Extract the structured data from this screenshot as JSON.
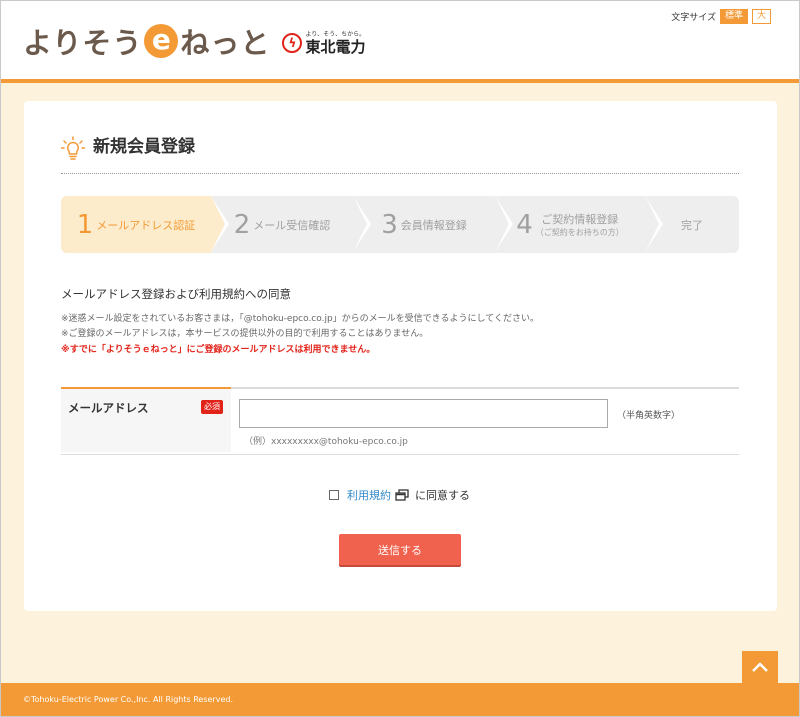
{
  "header": {
    "logo_text_1": "よりそう",
    "logo_e": "e",
    "logo_text_2": "ねっと",
    "brand_tag": "より、そう、ちから。",
    "brand_name": "東北電力",
    "font_size_label": "文字サイズ",
    "font_size_standard": "標準",
    "font_size_large": "大"
  },
  "main": {
    "title": "新規会員登録",
    "steps": [
      {
        "num": "1",
        "label": "メールアドレス認証",
        "sub": ""
      },
      {
        "num": "2",
        "label": "メール受信確認",
        "sub": ""
      },
      {
        "num": "3",
        "label": "会員情報登録",
        "sub": ""
      },
      {
        "num": "4",
        "label": "ご契約情報登録",
        "sub": "（ご契約をお持ちの方）"
      },
      {
        "num": "",
        "label": "完了",
        "sub": ""
      }
    ],
    "notice_title": "メールアドレス登録および利用規約への同意",
    "notes": [
      "※迷惑メール設定をされているお客さまは，「@tohoku-epco.co.jp」からのメールを受信できるようにしてください。",
      "※ご登録のメールアドレスは，本サービスの提供以外の目的で利用することはありません。",
      "※すでに「よりそうｅねっと」にご登録のメールアドレスは利用できません。"
    ],
    "form": {
      "email_label": "メールアドレス",
      "required": "必須",
      "email_value": "",
      "email_placeholder": "",
      "hankaku": "（半角英数字）",
      "example": "（例）xxxxxxxxx@tohoku-epco.co.jp"
    },
    "agree": {
      "terms_link": "利用規約",
      "agree_text": "に同意する"
    },
    "submit_label": "送信する"
  },
  "footer": {
    "copyright": "©Tohoku-Electric Power Co.,Inc. All Rights Reserved."
  },
  "colors": {
    "accent": "#f39a36",
    "danger": "#e2231a",
    "submit": "#f0624d",
    "link": "#3389c9"
  }
}
